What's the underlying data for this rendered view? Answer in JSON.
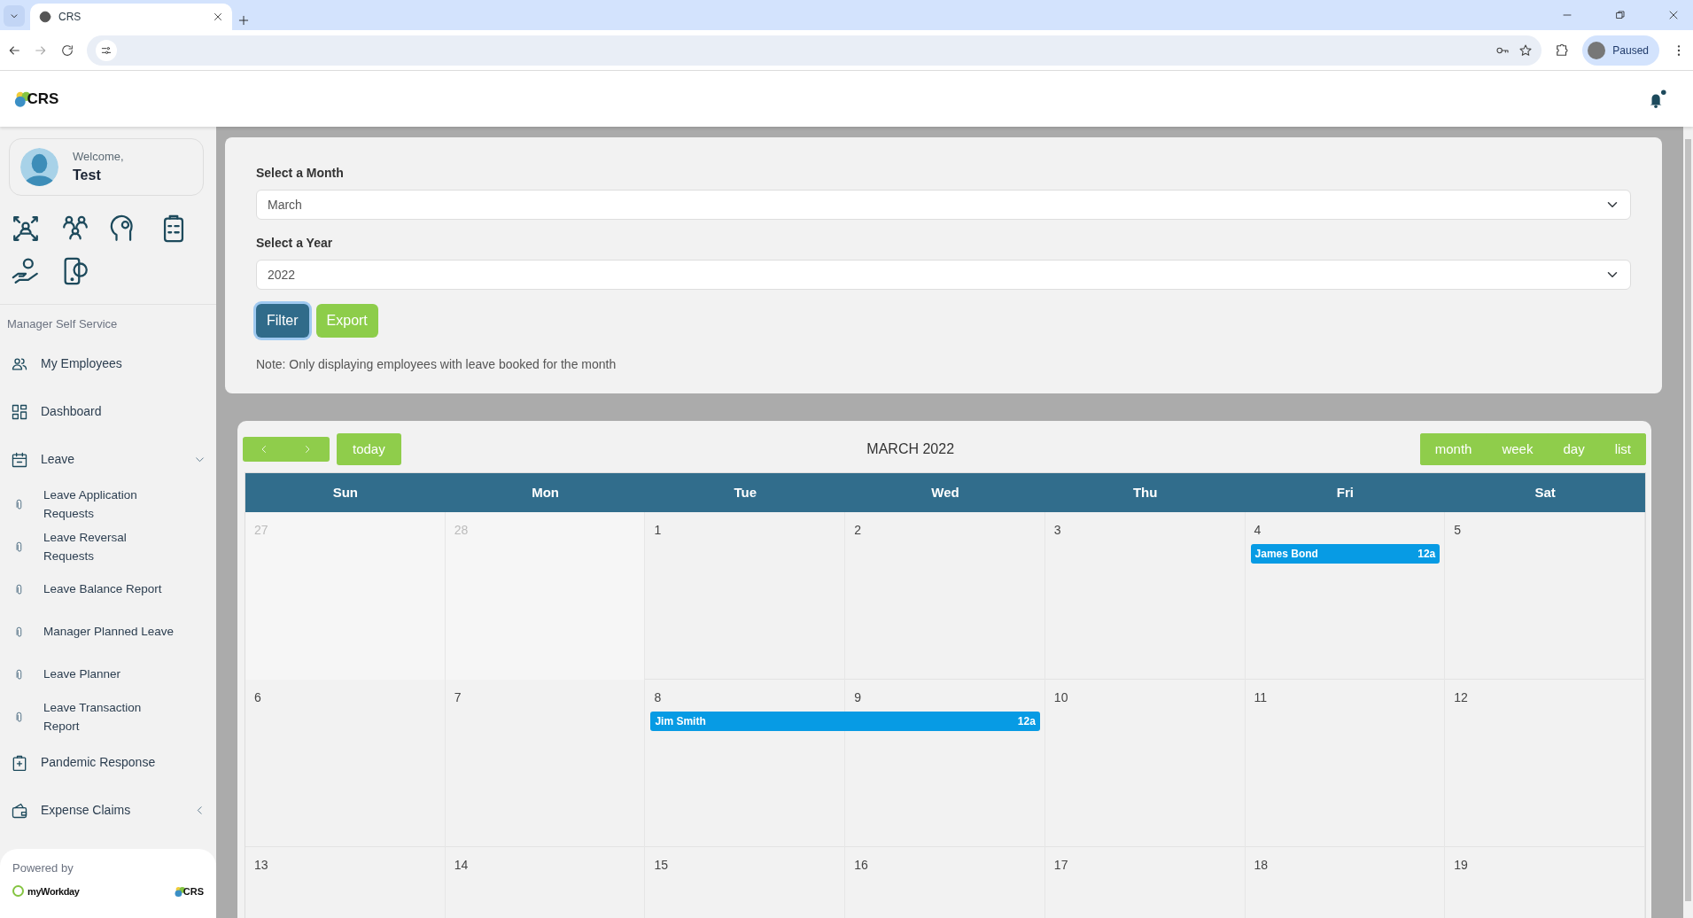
{
  "browser": {
    "tab_title": "CRS",
    "profile_label": "Paused"
  },
  "app_header": {
    "logo_text": "CRS"
  },
  "sidebar": {
    "welcome": "Welcome,",
    "user_name": "Test",
    "section_title": "Manager Self Service",
    "items": [
      {
        "kind": "link",
        "label": "My Employees"
      },
      {
        "kind": "link",
        "label": "Dashboard"
      },
      {
        "kind": "group",
        "label": "Leave",
        "expanded": true,
        "children": [
          {
            "label": "Leave Application Requests"
          },
          {
            "label": "Leave Reversal Requests"
          },
          {
            "label": "Leave Balance Report"
          },
          {
            "label": "Manager Planned Leave"
          },
          {
            "label": "Leave Planner"
          },
          {
            "label": "Leave Transaction Report"
          }
        ]
      },
      {
        "kind": "link",
        "label": "Pandemic Response"
      },
      {
        "kind": "group",
        "label": "Expense Claims",
        "expanded": false
      }
    ],
    "footer": {
      "powered_by": "Powered by",
      "partner_logo": "myWorkday",
      "logo_text": "CRS"
    }
  },
  "filter": {
    "month_label": "Select a Month",
    "month_value": "March",
    "year_label": "Select a Year",
    "year_value": "2022",
    "buttons": [
      "Filter",
      "Export"
    ],
    "note": "Note: Only displaying employees with leave booked for the month"
  },
  "calendar": {
    "title": "MARCH 2022",
    "today_label": "today",
    "views": [
      {
        "label": "month",
        "selected": false
      },
      {
        "label": "week",
        "selected": false
      },
      {
        "label": "day",
        "selected": false
      },
      {
        "label": "list",
        "selected": false
      }
    ],
    "weekdays": [
      "Sun",
      "Mon",
      "Tue",
      "Wed",
      "Thu",
      "Fri",
      "Sat"
    ],
    "weeks": [
      {
        "days": [
          {
            "label": "27",
            "other_month": true
          },
          {
            "label": "28",
            "other_month": true
          },
          {
            "label": "1",
            "other_month": false
          },
          {
            "label": "2",
            "other_month": false
          },
          {
            "label": "3",
            "other_month": false
          },
          {
            "label": "4",
            "other_month": false,
            "events": [
              {
                "title": "James Bond",
                "time": "12a"
              }
            ]
          },
          {
            "label": "5",
            "other_month": false
          }
        ]
      },
      {
        "days": [
          {
            "label": "6",
            "other_month": false
          },
          {
            "label": "7",
            "other_month": false
          },
          {
            "label": "8",
            "other_month": false,
            "events": [
              {
                "title": "Jim Smith",
                "time": "12a"
              }
            ]
          },
          {
            "label": "9",
            "other_month": false,
            "continues_event": true
          },
          {
            "label": "10",
            "other_month": false
          },
          {
            "label": "11",
            "other_month": false
          },
          {
            "label": "12",
            "other_month": false
          }
        ]
      },
      {
        "days": [
          {
            "label": "13",
            "other_month": false
          },
          {
            "label": "14",
            "other_month": false
          },
          {
            "label": "15",
            "other_month": false
          },
          {
            "label": "16",
            "other_month": false
          },
          {
            "label": "17",
            "other_month": false
          },
          {
            "label": "18",
            "other_month": false
          },
          {
            "label": "19",
            "other_month": false
          }
        ]
      }
    ]
  }
}
